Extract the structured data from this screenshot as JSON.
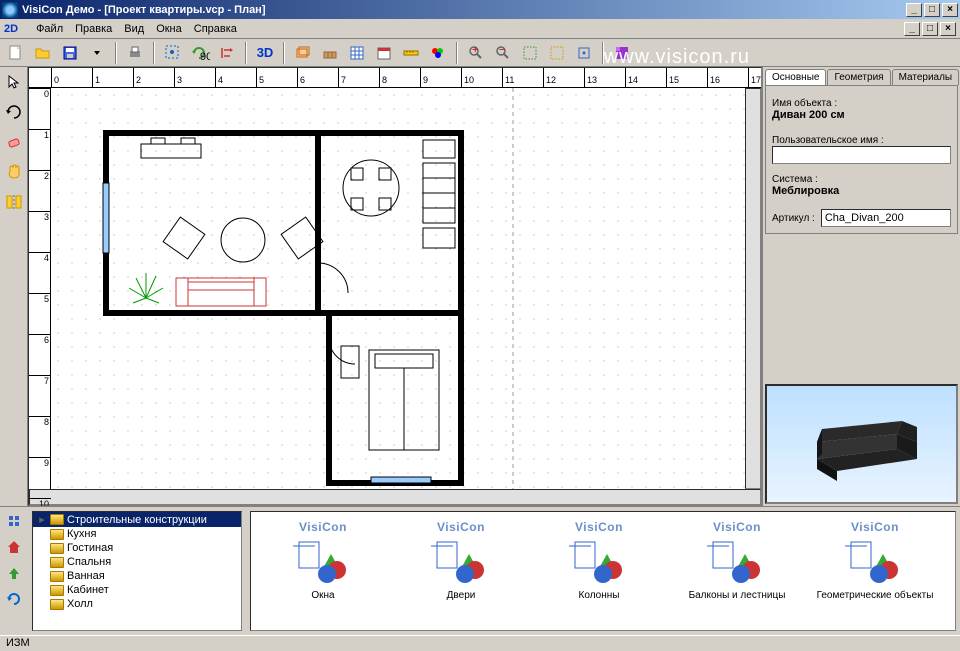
{
  "title": "VisiCon Демо - [Проект квартиры.vcp - План]",
  "menu": {
    "twoD": "2D",
    "file": "Файл",
    "edit": "Правка",
    "view": "Вид",
    "windows": "Окна",
    "help": "Справка"
  },
  "toolbar": {
    "threeD": "3D"
  },
  "watermark": "www.visicon.ru",
  "hruler_ticks": [
    "0",
    "1",
    "2",
    "3",
    "4",
    "5",
    "6",
    "7",
    "8",
    "9",
    "10",
    "11",
    "12",
    "13",
    "14",
    "15",
    "16",
    "17"
  ],
  "vruler_ticks": [
    "0",
    "1",
    "2",
    "3",
    "4",
    "5",
    "6",
    "7",
    "8",
    "9",
    "10"
  ],
  "rightpanel": {
    "tabs": {
      "main": "Основные",
      "geom": "Геометрия",
      "mat": "Материалы"
    },
    "name_label": "Имя объекта :",
    "name_value": "Диван 200 см",
    "user_label": "Пользовательское имя :",
    "user_value": "",
    "system_label": "Система :",
    "system_value": "Меблировка",
    "sku_label": "Артикул :",
    "sku_value": "Cha_Divan_200"
  },
  "library": {
    "tree": [
      "Строительные конструкции",
      "Кухня",
      "Гостиная",
      "Спальня",
      "Ванная",
      "Кабинет",
      "Холл"
    ],
    "items": [
      {
        "logo": "VisiCon",
        "label": "Окна"
      },
      {
        "logo": "VisiCon",
        "label": "Двери"
      },
      {
        "logo": "VisiCon",
        "label": "Колонны"
      },
      {
        "logo": "VisiCon",
        "label": "Балконы и лестницы"
      },
      {
        "logo": "VisiCon",
        "label": "Геометрические объекты"
      }
    ]
  },
  "status": "ИЗМ"
}
